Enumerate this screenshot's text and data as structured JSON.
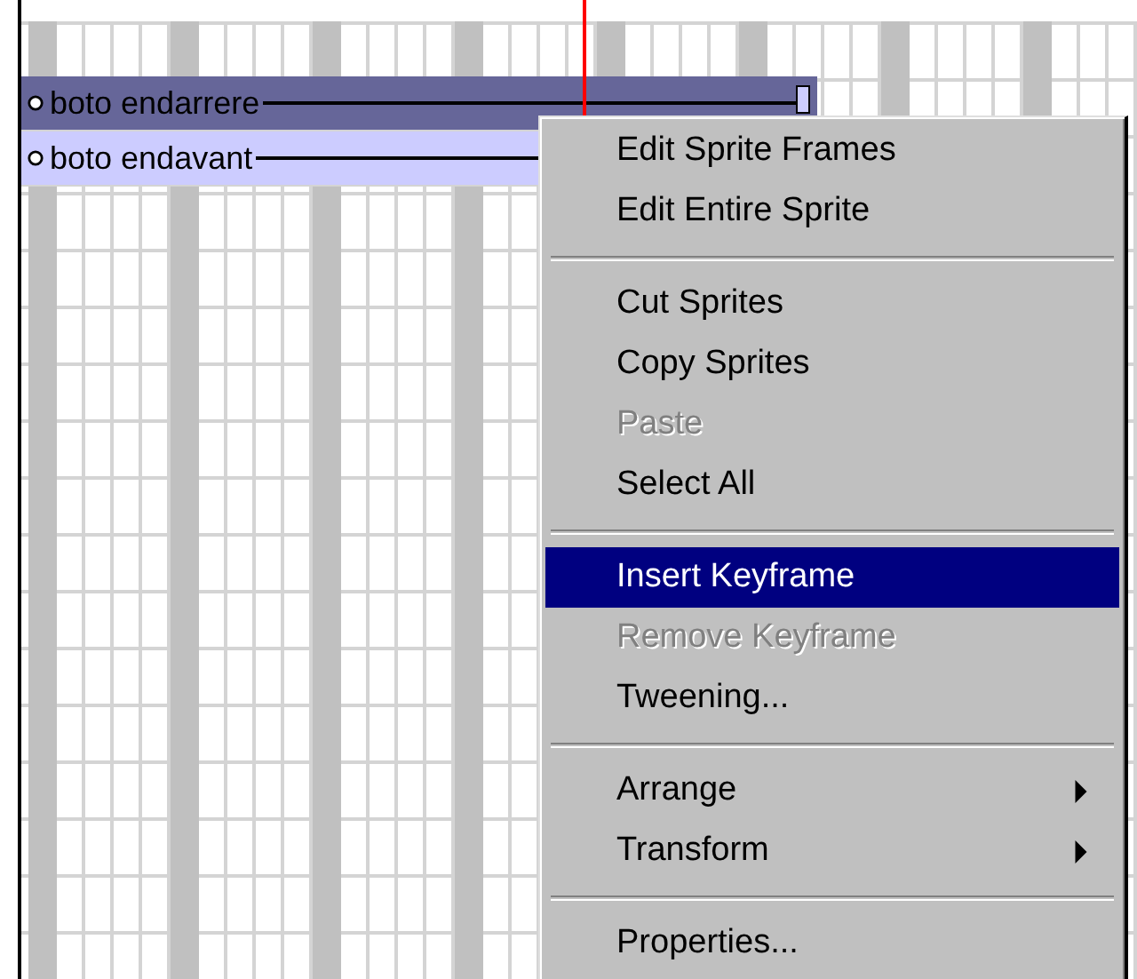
{
  "sprites": [
    {
      "label": "boto endarrere",
      "selected": true,
      "end_marker": true
    },
    {
      "label": "boto endavant",
      "selected": false
    }
  ],
  "context_menu": {
    "items": [
      {
        "kind": "item",
        "label": "Edit Sprite Frames",
        "disabled": false,
        "selected": false
      },
      {
        "kind": "item",
        "label": "Edit Entire Sprite",
        "disabled": false,
        "selected": false
      },
      {
        "kind": "separator"
      },
      {
        "kind": "item",
        "label": "Cut Sprites",
        "disabled": false,
        "selected": false
      },
      {
        "kind": "item",
        "label": "Copy Sprites",
        "disabled": false,
        "selected": false
      },
      {
        "kind": "item",
        "label": "Paste",
        "disabled": true,
        "selected": false
      },
      {
        "kind": "item",
        "label": "Select All",
        "disabled": false,
        "selected": false
      },
      {
        "kind": "separator"
      },
      {
        "kind": "item",
        "label": "Insert Keyframe",
        "disabled": false,
        "selected": true
      },
      {
        "kind": "item",
        "label": "Remove Keyframe",
        "disabled": true,
        "selected": false
      },
      {
        "kind": "item",
        "label": "Tweening...",
        "disabled": false,
        "selected": false
      },
      {
        "kind": "separator"
      },
      {
        "kind": "submenu",
        "label": "Arrange",
        "disabled": false,
        "selected": false
      },
      {
        "kind": "submenu",
        "label": "Transform",
        "disabled": false,
        "selected": false
      },
      {
        "kind": "separator"
      },
      {
        "kind": "item",
        "label": "Properties...",
        "disabled": false,
        "selected": false
      }
    ]
  }
}
